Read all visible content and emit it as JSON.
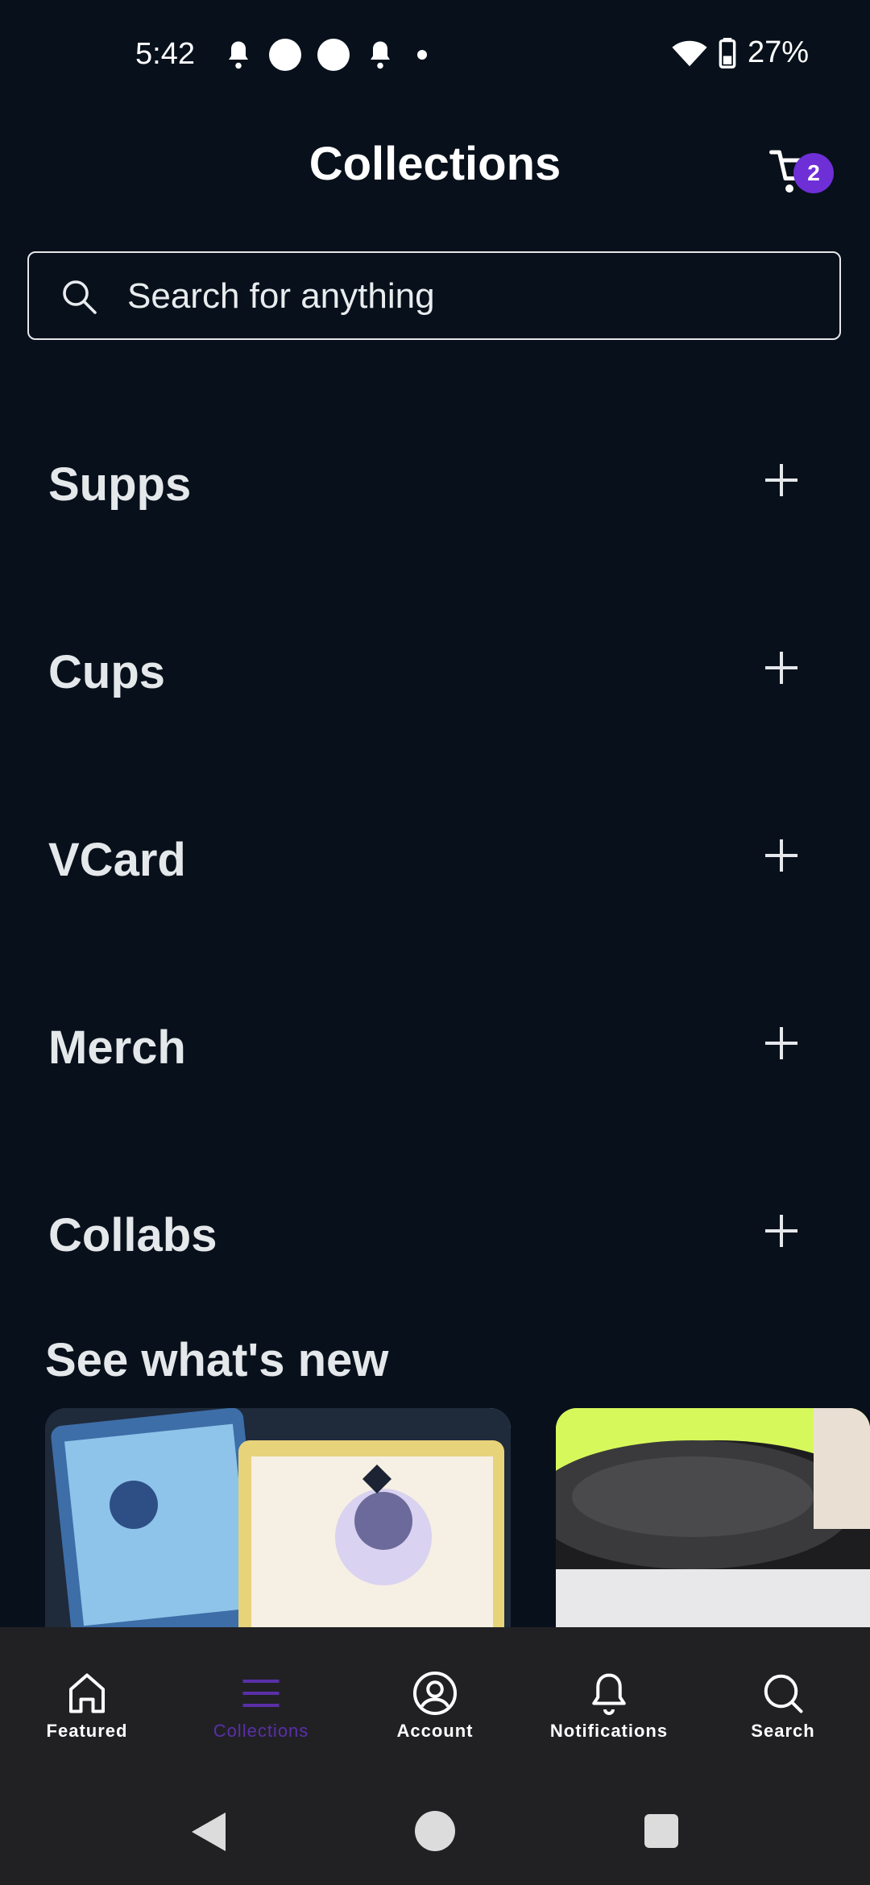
{
  "status_bar": {
    "time": "5:42",
    "battery": "27%"
  },
  "header": {
    "title": "Collections",
    "cart_count": "2"
  },
  "search": {
    "placeholder": "Search for anything"
  },
  "collections": [
    {
      "label": "Supps"
    },
    {
      "label": "Cups"
    },
    {
      "label": "VCard"
    },
    {
      "label": "Merch"
    },
    {
      "label": "Collabs"
    }
  ],
  "whats_new": {
    "title": "See what's new"
  },
  "bottom_nav": {
    "items": [
      {
        "label": "Featured",
        "icon": "home-icon"
      },
      {
        "label": "Collections",
        "icon": "menu-icon",
        "active": true
      },
      {
        "label": "Account",
        "icon": "account-icon"
      },
      {
        "label": "Notifications",
        "icon": "bell-icon"
      },
      {
        "label": "Search",
        "icon": "search-icon"
      }
    ]
  },
  "colors": {
    "background": "#08111b",
    "accent": "#6e2fd6",
    "nav_background": "#212124"
  }
}
